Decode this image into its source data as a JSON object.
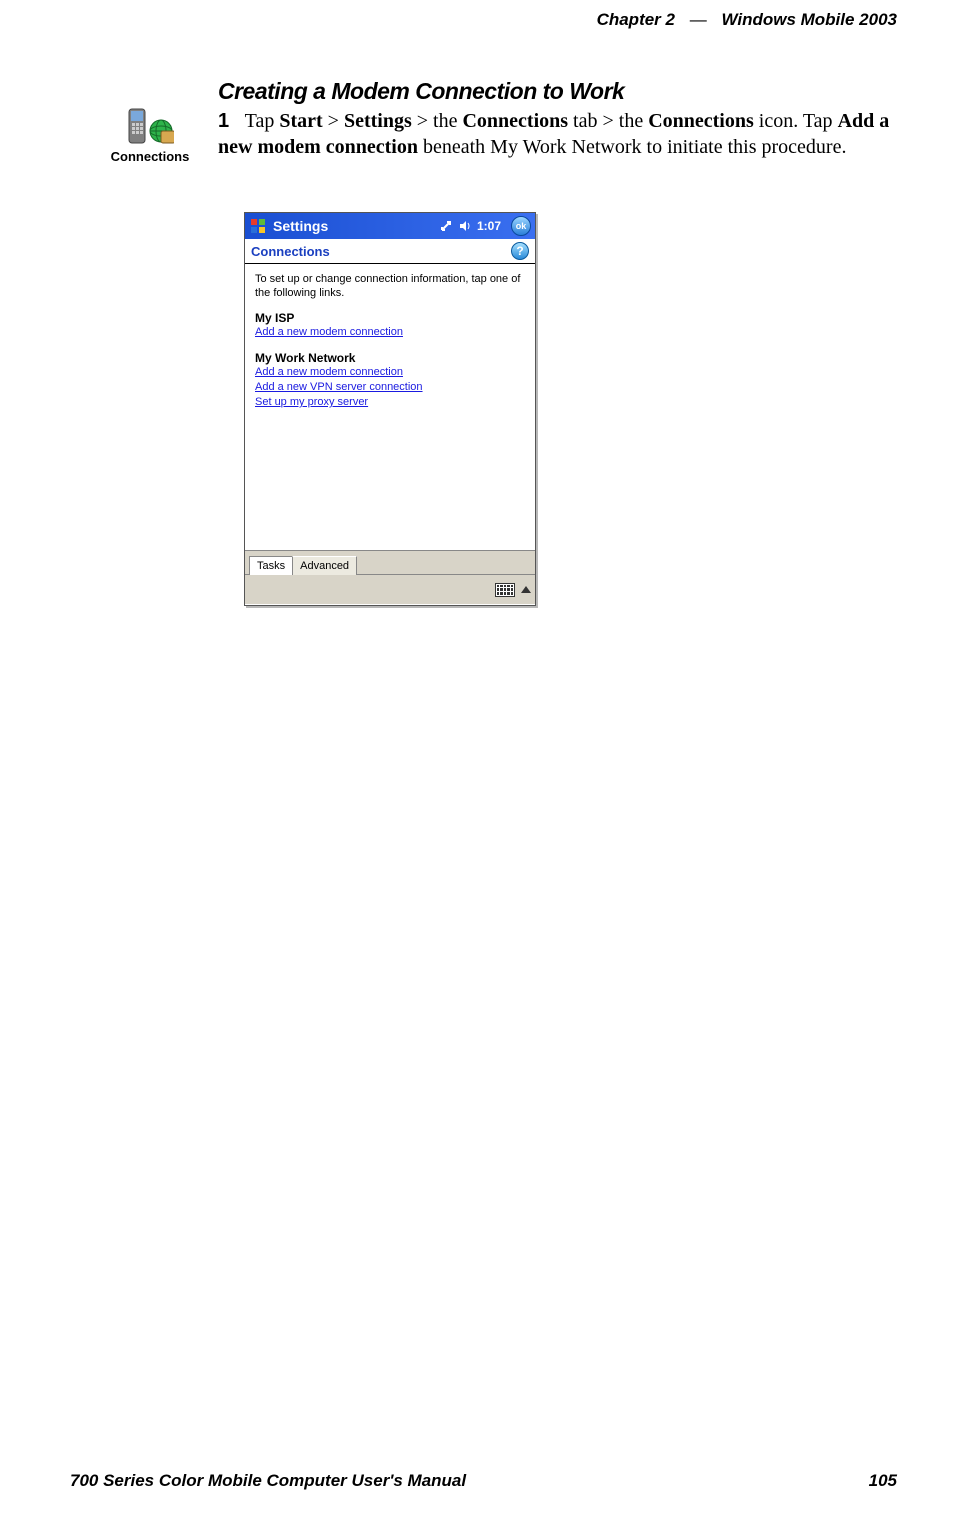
{
  "header": {
    "chapter": "Chapter 2",
    "dash": "—",
    "title": "Windows Mobile 2003"
  },
  "footer": {
    "manual": "700 Series Color Mobile Computer User's Manual",
    "page": "105"
  },
  "section_title": "Creating a Modem Connection to Work",
  "step": {
    "num": "1",
    "t_tap": "Tap ",
    "t_start": "Start",
    "t_gt1": " > ",
    "t_settings": "Settings",
    "t_gt2": " > the ",
    "t_conn_tab": "Connections",
    "t_tab_after": " tab > the ",
    "t_conn_icon": "Connections",
    "t_icon_after": " icon. Tap ",
    "t_addnew": "Add a new modem connection",
    "t_rest": " beneath My Work Network to initiate this procedure."
  },
  "conn_icon_label": "Connections",
  "screenshot": {
    "titlebar_title": "Settings",
    "time": "1:07",
    "ok": "ok",
    "app_title": "Connections",
    "help_q": "?",
    "intro": "To set up or change connection information, tap one of the following links.",
    "isp_title": "My ISP",
    "isp_links": [
      "Add a new modem connection"
    ],
    "work_title": "My Work Network",
    "work_links": [
      "Add a new modem connection",
      "Add a new VPN server connection",
      "Set up my proxy server"
    ],
    "tabs": {
      "tasks": "Tasks",
      "advanced": "Advanced"
    }
  }
}
